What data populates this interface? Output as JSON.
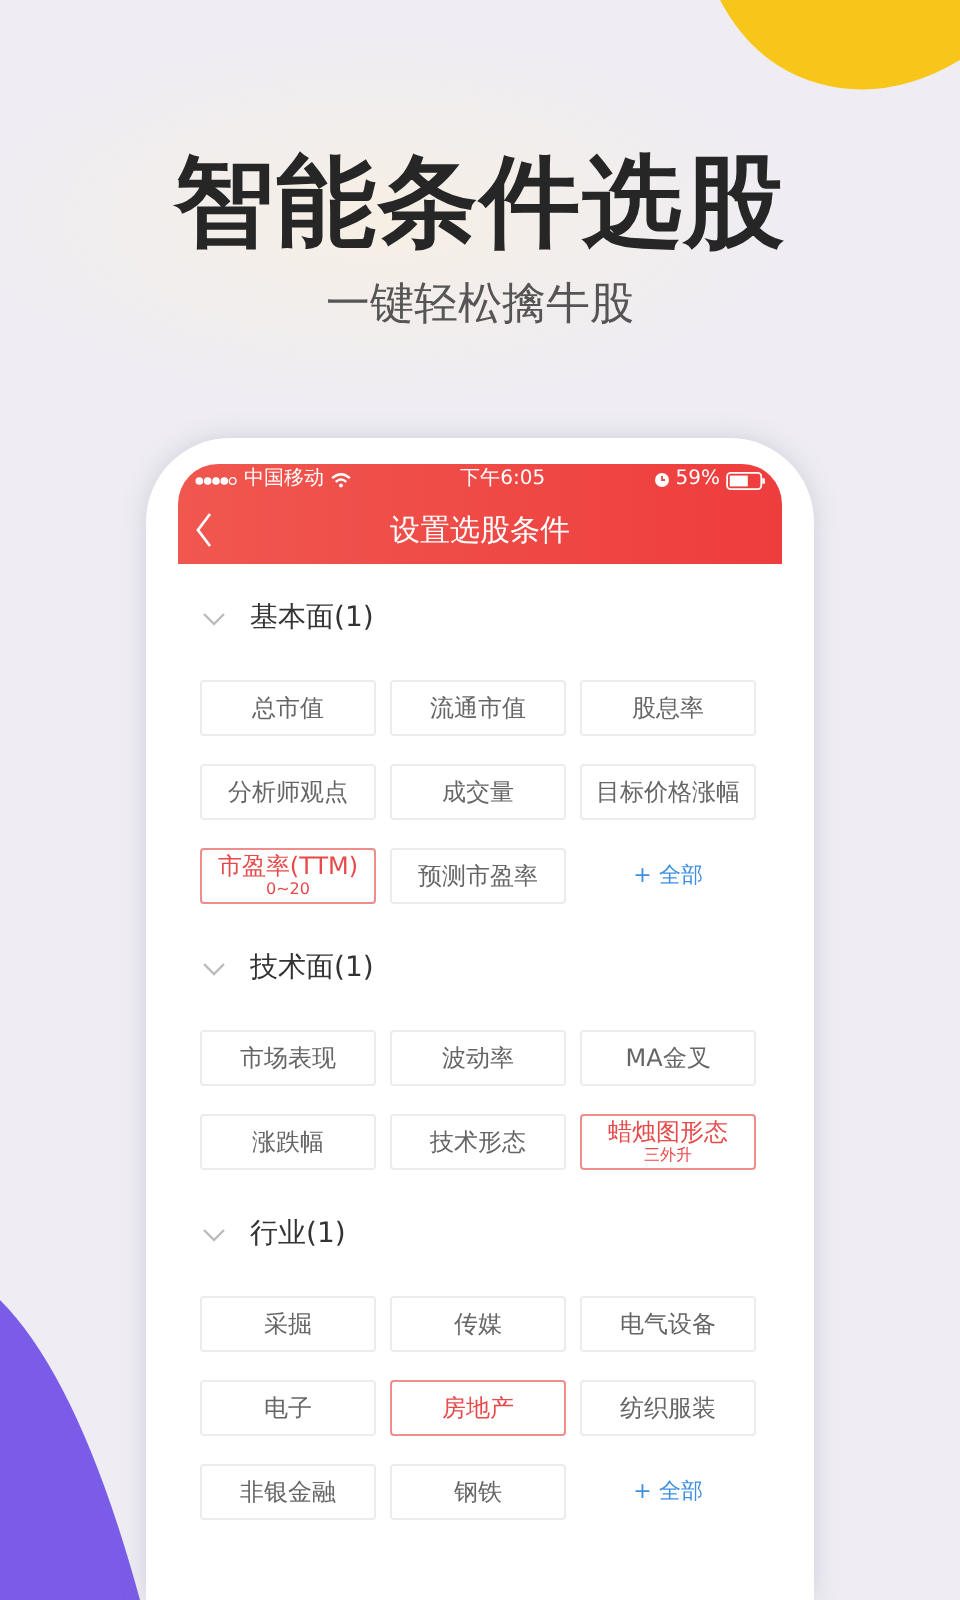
{
  "headline": "智能条件选股",
  "subheadline": "一键轻松擒牛股",
  "status_bar": {
    "carrier": "中国移动",
    "time": "下午6:05",
    "battery": "59%"
  },
  "nav": {
    "title": "设置选股条件"
  },
  "sections": [
    {
      "title": "基本面(1)",
      "options": [
        {
          "kind": "option",
          "label": "总市值",
          "selected": false
        },
        {
          "kind": "option",
          "label": "流通市值",
          "selected": false
        },
        {
          "kind": "option",
          "label": "股息率",
          "selected": false
        },
        {
          "kind": "option",
          "label": "分析师观点",
          "selected": false
        },
        {
          "kind": "option",
          "label": "成交量",
          "selected": false
        },
        {
          "kind": "option",
          "label": "目标价格涨幅",
          "selected": false
        },
        {
          "kind": "option",
          "label": "市盈率(TTM)",
          "sub": "0~20",
          "selected": true
        },
        {
          "kind": "option",
          "label": "预测市盈率",
          "selected": false
        },
        {
          "kind": "all",
          "label": "+ 全部"
        }
      ]
    },
    {
      "title": "技术面(1)",
      "options": [
        {
          "kind": "option",
          "label": "市场表现",
          "selected": false
        },
        {
          "kind": "option",
          "label": "波动率",
          "selected": false
        },
        {
          "kind": "option",
          "label": "MA金叉",
          "selected": false
        },
        {
          "kind": "option",
          "label": "涨跌幅",
          "selected": false
        },
        {
          "kind": "option",
          "label": "技术形态",
          "selected": false
        },
        {
          "kind": "option",
          "label": "蜡烛图形态",
          "sub": "三外升",
          "selected": true
        }
      ]
    },
    {
      "title": "行业(1)",
      "options": [
        {
          "kind": "option",
          "label": "采掘",
          "selected": false
        },
        {
          "kind": "option",
          "label": "传媒",
          "selected": false
        },
        {
          "kind": "option",
          "label": "电气设备",
          "selected": false
        },
        {
          "kind": "option",
          "label": "电子",
          "selected": false
        },
        {
          "kind": "option",
          "label": "房地产",
          "selected": true
        },
        {
          "kind": "option",
          "label": "纺织服装",
          "selected": false
        },
        {
          "kind": "option",
          "label": "非银金融",
          "selected": false
        },
        {
          "kind": "option",
          "label": "钢铁",
          "selected": false
        },
        {
          "kind": "all",
          "label": "+ 全部"
        }
      ]
    }
  ]
}
